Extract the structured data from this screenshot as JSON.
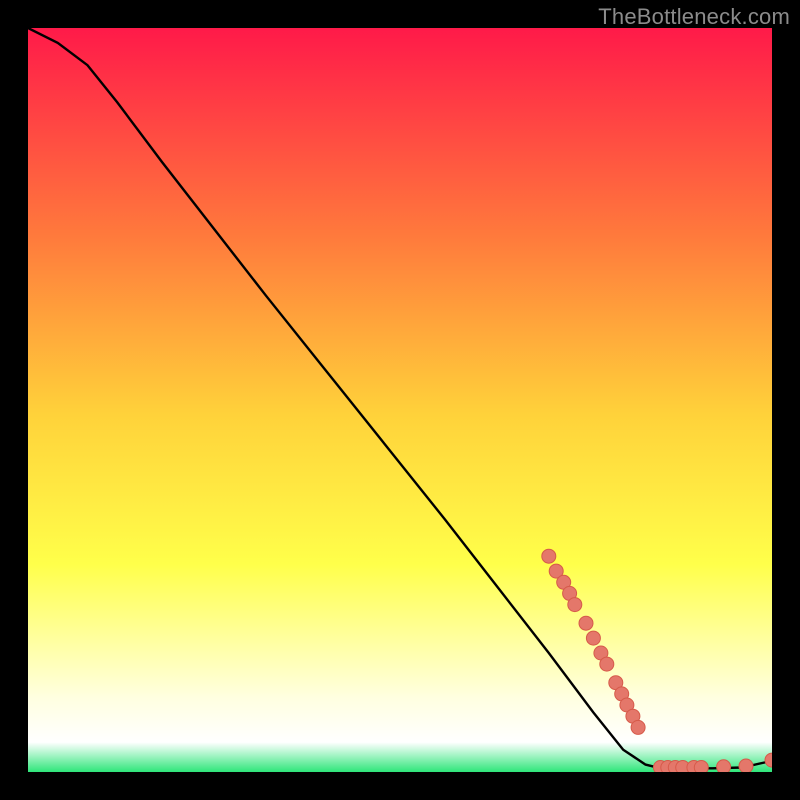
{
  "watermark": "TheBottleneck.com",
  "colors": {
    "background": "#000000",
    "curve": "#000000",
    "marker_fill": "#e4776a",
    "marker_stroke": "#d65a4a",
    "gradient_top": "#ff1a49",
    "gradient_mid1": "#ff7a3c",
    "gradient_mid2": "#ffd23a",
    "gradient_mid3": "#ffff4a",
    "gradient_pale": "#ffffe0",
    "gradient_green": "#2ee67a"
  },
  "chart_data": {
    "type": "line",
    "title": "",
    "xlabel": "",
    "ylabel": "",
    "xlim": [
      0,
      100
    ],
    "ylim": [
      0,
      100
    ],
    "series": [
      {
        "name": "curve",
        "x": [
          0,
          4,
          8,
          12,
          18,
          25,
          32,
          40,
          48,
          56,
          63,
          70,
          76,
          80,
          83,
          85,
          88,
          92,
          96,
          100
        ],
        "y": [
          100,
          98,
          95,
          90,
          82,
          73,
          64,
          54,
          44,
          34,
          25,
          16,
          8,
          3,
          1,
          0.5,
          0.5,
          0.5,
          0.6,
          1.5
        ]
      }
    ],
    "markers": [
      {
        "x": 70.0,
        "y": 29.0
      },
      {
        "x": 71.0,
        "y": 27.0
      },
      {
        "x": 72.0,
        "y": 25.5
      },
      {
        "x": 72.8,
        "y": 24.0
      },
      {
        "x": 73.5,
        "y": 22.5
      },
      {
        "x": 75.0,
        "y": 20.0
      },
      {
        "x": 76.0,
        "y": 18.0
      },
      {
        "x": 77.0,
        "y": 16.0
      },
      {
        "x": 77.8,
        "y": 14.5
      },
      {
        "x": 79.0,
        "y": 12.0
      },
      {
        "x": 79.8,
        "y": 10.5
      },
      {
        "x": 80.5,
        "y": 9.0
      },
      {
        "x": 81.3,
        "y": 7.5
      },
      {
        "x": 82.0,
        "y": 6.0
      },
      {
        "x": 85.0,
        "y": 0.6
      },
      {
        "x": 86.0,
        "y": 0.6
      },
      {
        "x": 87.0,
        "y": 0.6
      },
      {
        "x": 88.0,
        "y": 0.6
      },
      {
        "x": 89.5,
        "y": 0.6
      },
      {
        "x": 90.5,
        "y": 0.6
      },
      {
        "x": 93.5,
        "y": 0.7
      },
      {
        "x": 96.5,
        "y": 0.8
      },
      {
        "x": 100.0,
        "y": 1.6
      }
    ]
  }
}
